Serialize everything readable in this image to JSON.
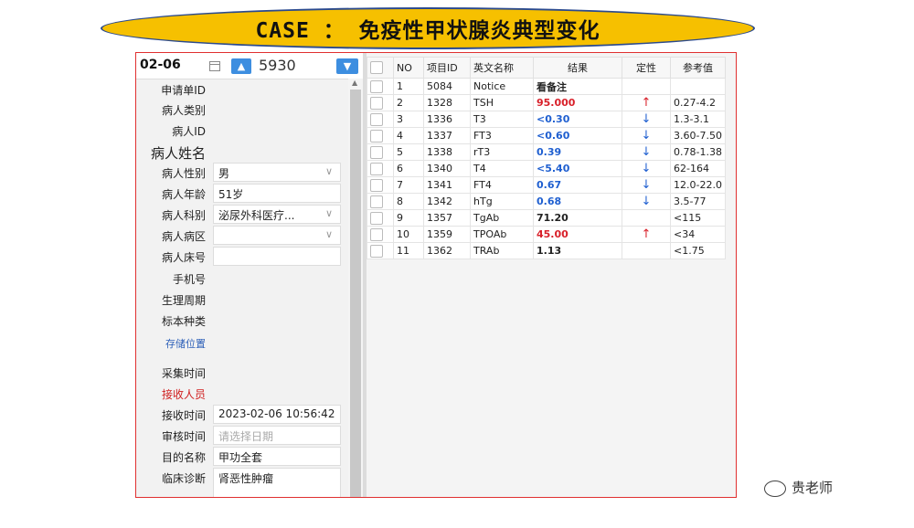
{
  "banner": {
    "title": "CASE ： 免疫性甲状腺炎典型变化"
  },
  "topbar": {
    "date": "02-06",
    "number": "5930",
    "up_glyph": "▲",
    "down_glyph": "▼"
  },
  "fields": [
    {
      "key": "申请单ID",
      "value": ""
    },
    {
      "key": "病人类别",
      "value": ""
    },
    {
      "key": "病人ID",
      "value": ""
    },
    {
      "key": "病人姓名",
      "value": ""
    },
    {
      "key": "病人性别",
      "value": "男"
    },
    {
      "key": "病人年龄",
      "value": "51岁"
    },
    {
      "key": "病人科别",
      "value": "泌尿外科医疗..."
    },
    {
      "key": "病人病区",
      "value": ""
    },
    {
      "key": "病人床号",
      "value": ""
    },
    {
      "key": "手机号",
      "value": ""
    },
    {
      "key": "生理周期",
      "value": ""
    },
    {
      "key": "标本种类",
      "value": ""
    },
    {
      "key": "存储位置",
      "value": ""
    },
    {
      "key": "采集时间",
      "value": ""
    },
    {
      "key": "接收人员",
      "value": ""
    },
    {
      "key": "接收时间",
      "value": "2023-02-06 10:56:42"
    },
    {
      "key": "审核时间",
      "value": "",
      "placeholder": "请选择日期"
    },
    {
      "key": "目的名称",
      "value": "甲功全套"
    },
    {
      "key": "临床诊断",
      "value": "肾恶性肿瘤"
    }
  ],
  "table": {
    "headers": [
      "NO",
      "项目ID",
      "英文名称",
      "结果",
      "定性",
      "参考值"
    ],
    "rows": [
      {
        "no": "1",
        "id": "5084",
        "name": "Notice",
        "result": "看备注",
        "flag": "",
        "ref": "",
        "color": "#222222"
      },
      {
        "no": "2",
        "id": "1328",
        "name": "TSH",
        "result": "95.000",
        "flag": "↑",
        "ref": "0.27-4.2",
        "color": "#d8202a"
      },
      {
        "no": "3",
        "id": "1336",
        "name": "T3",
        "result": "<0.30",
        "flag": "↓",
        "ref": "1.3-3.1",
        "color": "#1f5fd0"
      },
      {
        "no": "4",
        "id": "1337",
        "name": "FT3",
        "result": "<0.60",
        "flag": "↓",
        "ref": "3.60-7.50",
        "color": "#1f5fd0"
      },
      {
        "no": "5",
        "id": "1338",
        "name": "rT3",
        "result": "0.39",
        "flag": "↓",
        "ref": "0.78-1.38",
        "color": "#1f5fd0"
      },
      {
        "no": "6",
        "id": "1340",
        "name": "T4",
        "result": "<5.40",
        "flag": "↓",
        "ref": "62-164",
        "color": "#1f5fd0"
      },
      {
        "no": "7",
        "id": "1341",
        "name": "FT4",
        "result": "0.67",
        "flag": "↓",
        "ref": "12.0-22.0",
        "color": "#1f5fd0"
      },
      {
        "no": "8",
        "id": "1342",
        "name": "hTg",
        "result": "0.68",
        "flag": "↓",
        "ref": "3.5-77",
        "color": "#1f5fd0"
      },
      {
        "no": "9",
        "id": "1357",
        "name": "TgAb",
        "result": "71.20",
        "flag": "",
        "ref": "<115",
        "color": "#222222"
      },
      {
        "no": "10",
        "id": "1359",
        "name": "TPOAb",
        "result": "45.00",
        "flag": "↑",
        "ref": "<34",
        "color": "#d8202a"
      },
      {
        "no": "11",
        "id": "1362",
        "name": "TRAb",
        "result": "1.13",
        "flag": "",
        "ref": "<1.75",
        "color": "#222222"
      }
    ]
  },
  "watermark": {
    "text": "贵老师"
  },
  "colors": {
    "accent": "#3d8ee0",
    "high": "#d8202a",
    "low": "#1f5fd0",
    "banner": "#f6c000",
    "frame": "#e03030"
  }
}
